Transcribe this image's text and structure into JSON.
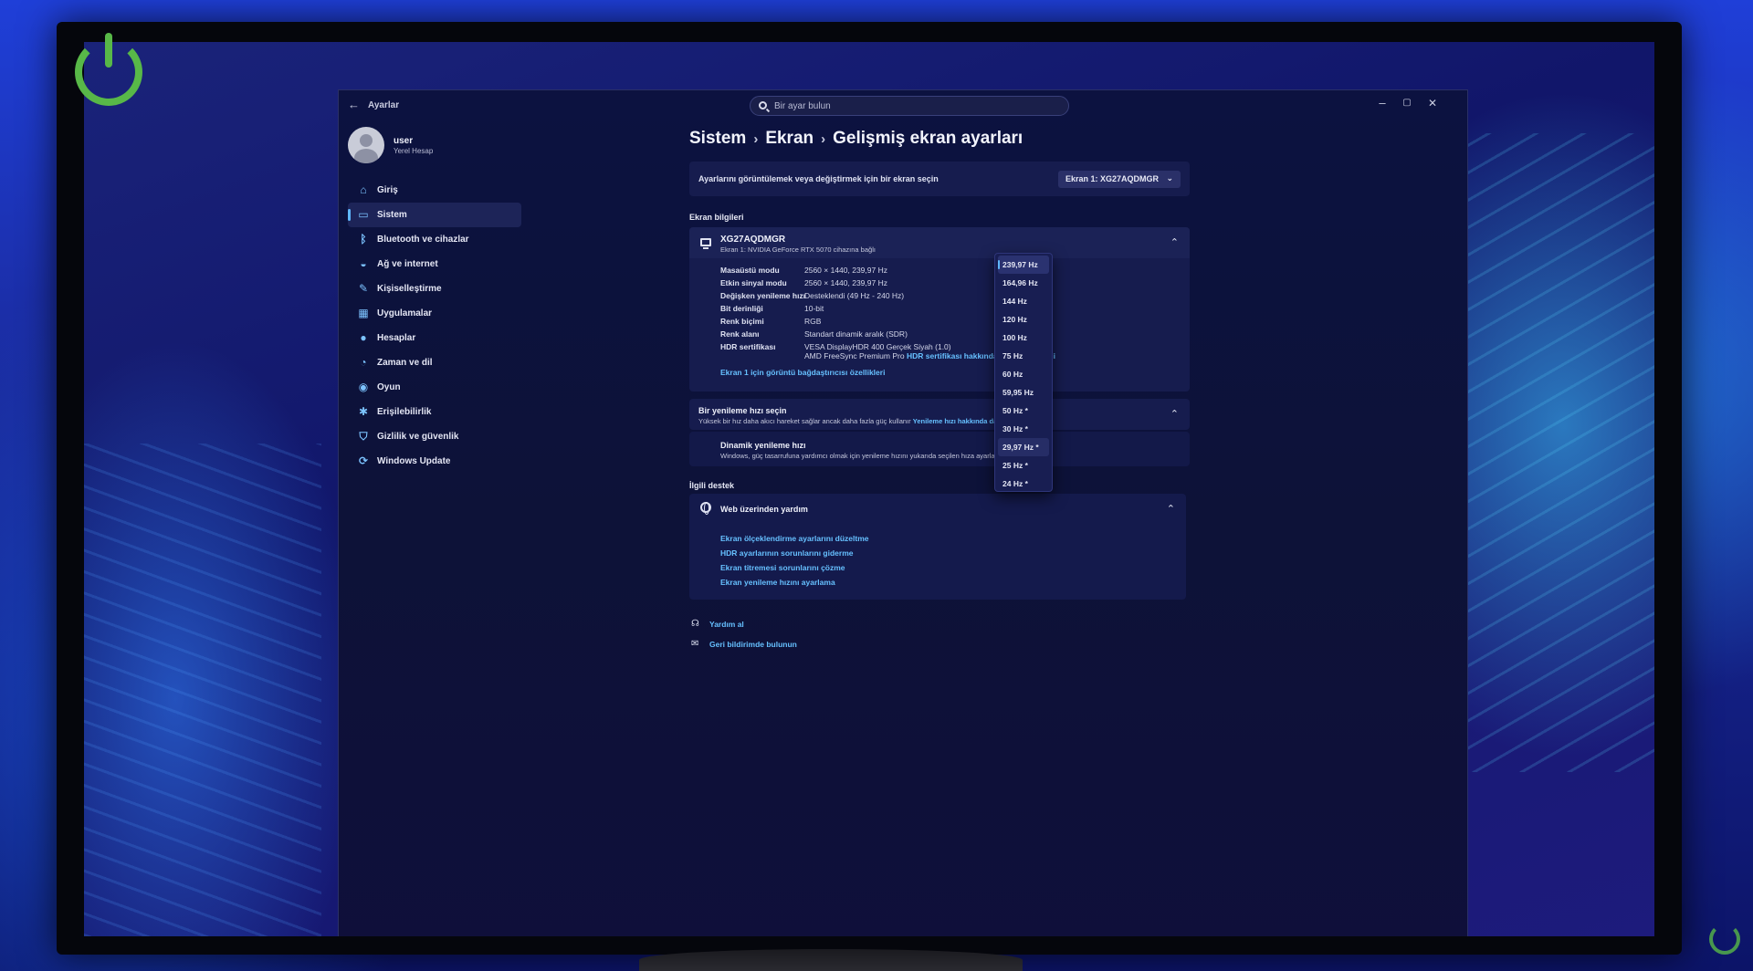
{
  "window": {
    "app_title": "Ayarlar",
    "search_placeholder": "Bir ayar bulun",
    "controls": [
      "–",
      "▢",
      "✕"
    ]
  },
  "profile": {
    "name": "user",
    "account_type": "Yerel Hesap"
  },
  "sidebar": {
    "items": [
      {
        "label": "Giriş",
        "icon": "home-icon",
        "glyph": "⌂"
      },
      {
        "label": "Sistem",
        "icon": "system-icon",
        "glyph": "▭",
        "active": true
      },
      {
        "label": "Bluetooth ve cihazlar",
        "icon": "bluetooth-icon",
        "glyph": "ᛒ"
      },
      {
        "label": "Ağ ve internet",
        "icon": "wifi-icon",
        "glyph": "◒"
      },
      {
        "label": "Kişiselleştirme",
        "icon": "brush-icon",
        "glyph": "✎"
      },
      {
        "label": "Uygulamalar",
        "icon": "apps-icon",
        "glyph": "▦"
      },
      {
        "label": "Hesaplar",
        "icon": "accounts-icon",
        "glyph": "●"
      },
      {
        "label": "Zaman ve dil",
        "icon": "time-language-icon",
        "glyph": "◔"
      },
      {
        "label": "Oyun",
        "icon": "gaming-icon",
        "glyph": "◉"
      },
      {
        "label": "Erişilebilirlik",
        "icon": "accessibility-icon",
        "glyph": "✱"
      },
      {
        "label": "Gizlilik ve güvenlik",
        "icon": "shield-icon",
        "glyph": "⛉"
      },
      {
        "label": "Windows Update",
        "icon": "windows-update-icon",
        "glyph": "⟳"
      }
    ]
  },
  "breadcrumb": [
    "Sistem",
    "Ekran",
    "Gelişmiş ekran ayarları"
  ],
  "display_select": {
    "label": "Ayarlarını görüntülemek veya değiştirmek için bir ekran seçin",
    "value": "Ekran 1: XG27AQDMGR"
  },
  "display_info": {
    "section_title": "Ekran bilgileri",
    "monitor_name": "XG27AQDMGR",
    "monitor_sub": "Ekran 1: NVIDIA GeForce RTX 5070 cihazına bağlı",
    "rows": [
      {
        "k": "Masaüstü modu",
        "v": "2560 × 1440, 239,97 Hz"
      },
      {
        "k": "Etkin sinyal modu",
        "v": "2560 × 1440, 239,97 Hz"
      },
      {
        "k": "Değişken yenileme hızı",
        "v": "Desteklendi (49 Hz - 240 Hz)"
      },
      {
        "k": "Bit derinliği",
        "v": "10-bit"
      },
      {
        "k": "Renk biçimi",
        "v": "RGB"
      },
      {
        "k": "Renk alanı",
        "v": "Standart dinamik aralık (SDR)"
      }
    ],
    "hdr_label": "HDR sertifikası",
    "hdr_value_1": "VESA DisplayHDR 400 Gerçek Siyah (1.0)",
    "hdr_value_2": "AMD FreeSync Premium Pro",
    "hdr_link": "HDR sertifikası hakkında daha fazla bilgi",
    "adapter_link": "Ekran 1 için görüntü bağdaştırıcısı özellikleri"
  },
  "refresh": {
    "title": "Bir yenileme hızı seçin",
    "desc": "Yüksek bir hız daha akıcı hareket sağlar ancak daha fazla güç kullanır",
    "link": "Yenileme hızı hakkında daha fazla bilgi",
    "dynamic_title": "Dinamik yenileme hızı",
    "dynamic_desc": "Windows, güç tasarrufuna yardımcı olmak için yenileme hızını yukarıda seçilen hıza ayarlar",
    "options": [
      "239,97 Hz",
      "164,96 Hz",
      "144 Hz",
      "120 Hz",
      "100 Hz",
      "75 Hz",
      "60 Hz",
      "59,95 Hz",
      "50 Hz *",
      "30 Hz *",
      "29,97 Hz *",
      "25 Hz *",
      "24 Hz *"
    ],
    "selected_index": 0,
    "hover_index": 10
  },
  "support": {
    "section_title": "İlgili destek",
    "help_title": "Web üzerinden yardım",
    "links": [
      "Ekran ölçeklendirme ayarlarını düzeltme",
      "HDR ayarlarının sorunlarını giderme",
      "Ekran titremesi sorunlarını çözme",
      "Ekran yenileme hızını ayarlama"
    ]
  },
  "footer": {
    "get_help": "Yardım al",
    "feedback": "Geri bildirimde bulunun"
  },
  "colors": {
    "accent": "#5fb8ff",
    "link": "#66c0ff",
    "logo_green": "#58b848",
    "window_bg": "#0c1240"
  }
}
